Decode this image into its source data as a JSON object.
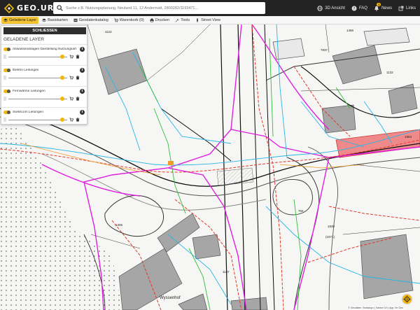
{
  "app": {
    "logo_text": "GEO.UR"
  },
  "search": {
    "placeholder": "Suche z.B. Nutzungsplanung, Neuland 11, 12 Andermatt, 2800282/1193471..."
  },
  "topnav": [
    {
      "label": "3D Ansicht",
      "icon": "globe-icon"
    },
    {
      "label": "FAQ",
      "icon": "question-icon"
    },
    {
      "label": "News",
      "icon": "bell-icon",
      "badge": "1"
    },
    {
      "label": "Links",
      "icon": "external-link-icon"
    }
  ],
  "toolbar": [
    {
      "label": "Geladene Layer",
      "icon": "layers-icon",
      "active": true
    },
    {
      "label": "Basiskarten",
      "icon": "basemap-icon"
    },
    {
      "label": "Geodatenkatalog",
      "icon": "catalog-icon"
    },
    {
      "label": "Warenkorb (0)",
      "icon": "cart-icon"
    },
    {
      "label": "Drucken",
      "icon": "printer-icon"
    },
    {
      "label": "Tools",
      "icon": "wrench-icon"
    },
    {
      "label": "Street View",
      "icon": "streetview-icon"
    }
  ],
  "panel": {
    "close_label": "SCHLIESSEN",
    "title": "GELADENE LAYER",
    "layers": [
      {
        "name": "Abwasseranlagen Darstellung Nutzungsart",
        "opacity": 0.95
      },
      {
        "name": "Elektro Leitungen",
        "opacity": 0.95
      },
      {
        "name": "Fernwärme Leitungen",
        "opacity": 0.95
      },
      {
        "name": "Swisscom Leitungen",
        "opacity": 0.95
      }
    ]
  },
  "map": {
    "labels": [
      "1122",
      "1486",
      "7837",
      "1132",
      "1305",
      "1863",
      "1830",
      "1137",
      "784",
      "(1971)"
    ],
    "place_label": "Wyssenhof",
    "attribution": "© Geodaten: Swisstopo | Kanton Uri | App: Ihr Geo"
  },
  "colors": {
    "accent": "#f2b705",
    "topbar": "#232323",
    "magenta": "#e020e0",
    "cyan": "#27b6e6",
    "red": "#e23a2a",
    "green": "#2fbf3a"
  }
}
